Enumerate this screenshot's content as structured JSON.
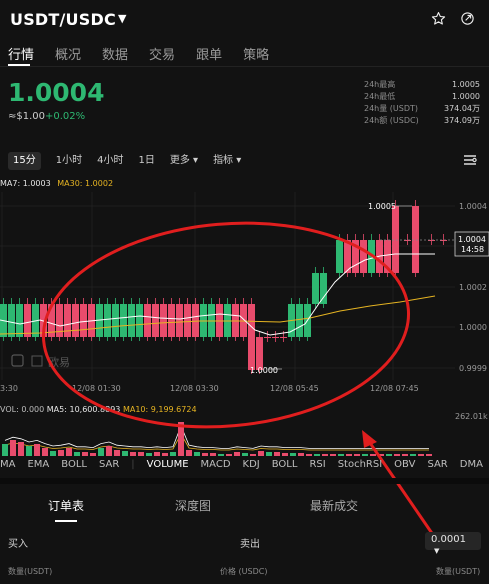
{
  "header": {
    "pair": "USDT/USDC",
    "caret": "▼",
    "star_icon": "star-icon",
    "share_icon": "share-icon"
  },
  "tabs": [
    "行情",
    "概况",
    "数据",
    "交易",
    "跟单",
    "策略"
  ],
  "price": {
    "last": "1.0004",
    "approx": "≈$1.00",
    "change": "+0.02%"
  },
  "stats": [
    {
      "label": "24h最高",
      "value": "1.0005"
    },
    {
      "label": "24h最低",
      "value": "1.0000"
    },
    {
      "label": "24h量 (USDT)",
      "value": "374.04万"
    },
    {
      "label": "24h额 (USDC)",
      "value": "374.09万"
    }
  ],
  "intervals": [
    "15分",
    "1小时",
    "4小时",
    "1日",
    "更多 ▾",
    "指标 ▾"
  ],
  "ma_legend": {
    "ma7": "MA7: 1.0003",
    "ma30": "MA30: 1.0002"
  },
  "chart_data": {
    "type": "candlestick",
    "y_ticks": [
      "1.0004",
      "1.0002",
      "1.0000",
      "0.9999"
    ],
    "x_ticks": [
      "3:30",
      "12/08 01:30",
      "12/08 03:30",
      "12/08 05:45",
      "12/08 07:45"
    ],
    "high_label": "1.0005",
    "low_label": "1.0000",
    "current_price_tag": "1.0004",
    "countdown": "14:58",
    "watermark": "欧易",
    "volume_axis_label": "262.01k",
    "colors": {
      "up": "#2eb872",
      "down": "#e84c6c",
      "ma7": "#ffffff",
      "ma30": "#e6b422",
      "annotation": "#e01e1e"
    }
  },
  "volume_legend": {
    "vol": "VOL: 0.000",
    "ma5": "MA5: 10,600.8893",
    "ma10": "MA10: 9,199.6724"
  },
  "indicator_tabs": [
    "MA",
    "EMA",
    "BOLL",
    "SAR",
    "VOLUME",
    "MACD",
    "KDJ",
    "BOLL",
    "RSI",
    "StochRSI",
    "OBV",
    "SAR",
    "DMA"
  ],
  "orderbook": {
    "tabs": [
      "订单表",
      "深度图",
      "最新成交"
    ],
    "buy": "买入",
    "sell": "卖出",
    "precision": "0.0001",
    "footer": [
      "数量(USDT)",
      "价格 (USDC)",
      "数量(USDT)"
    ]
  }
}
